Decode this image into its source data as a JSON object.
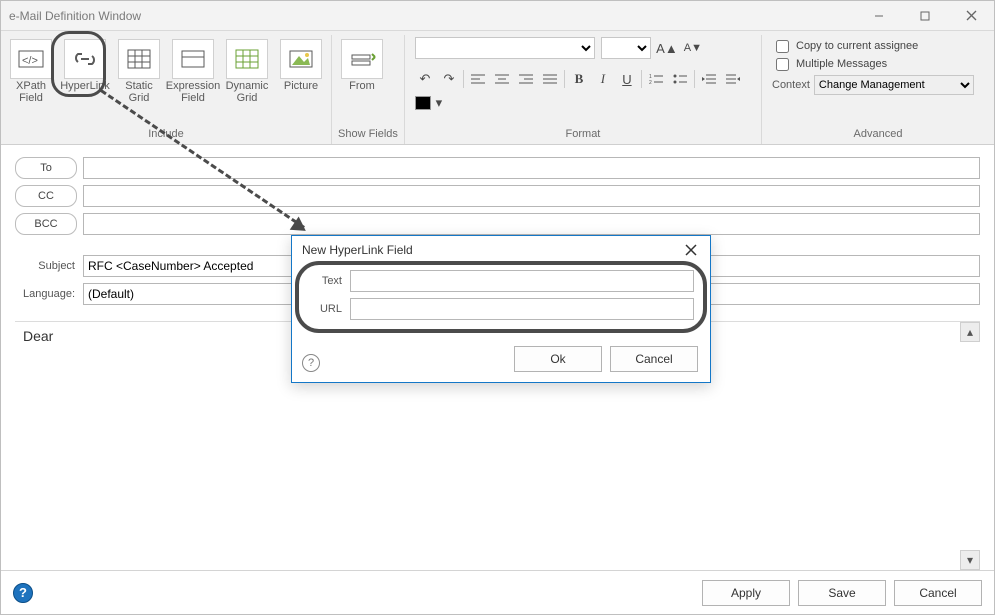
{
  "window": {
    "title": "e-Mail Definition Window"
  },
  "ribbon": {
    "include": {
      "label": "Include",
      "items": [
        {
          "label": "XPath\nField"
        },
        {
          "label": "HyperLink"
        },
        {
          "label": "Static\nGrid"
        },
        {
          "label": "Expression\nField"
        },
        {
          "label": "Dynamic\nGrid"
        },
        {
          "label": "Picture"
        }
      ]
    },
    "showfields": {
      "label": "Show Fields",
      "from": "From"
    },
    "format": {
      "label": "Format"
    },
    "advanced": {
      "label": "Advanced",
      "copy_assignee": "Copy to current assignee",
      "multi_msgs": "Multiple Messages",
      "context_label": "Context",
      "context_value": "Change Management"
    }
  },
  "form": {
    "to": "To",
    "cc": "CC",
    "bcc": "BCC",
    "subject_label": "Subject",
    "subject_value": "RFC <CaseNumber> Accepted",
    "language_label": "Language:",
    "language_value": "(Default)",
    "body": "Dear"
  },
  "dialog": {
    "title": "New HyperLink Field",
    "text_label": "Text",
    "url_label": "URL",
    "ok": "Ok",
    "cancel": "Cancel"
  },
  "footer": {
    "apply": "Apply",
    "save": "Save",
    "cancel": "Cancel"
  }
}
